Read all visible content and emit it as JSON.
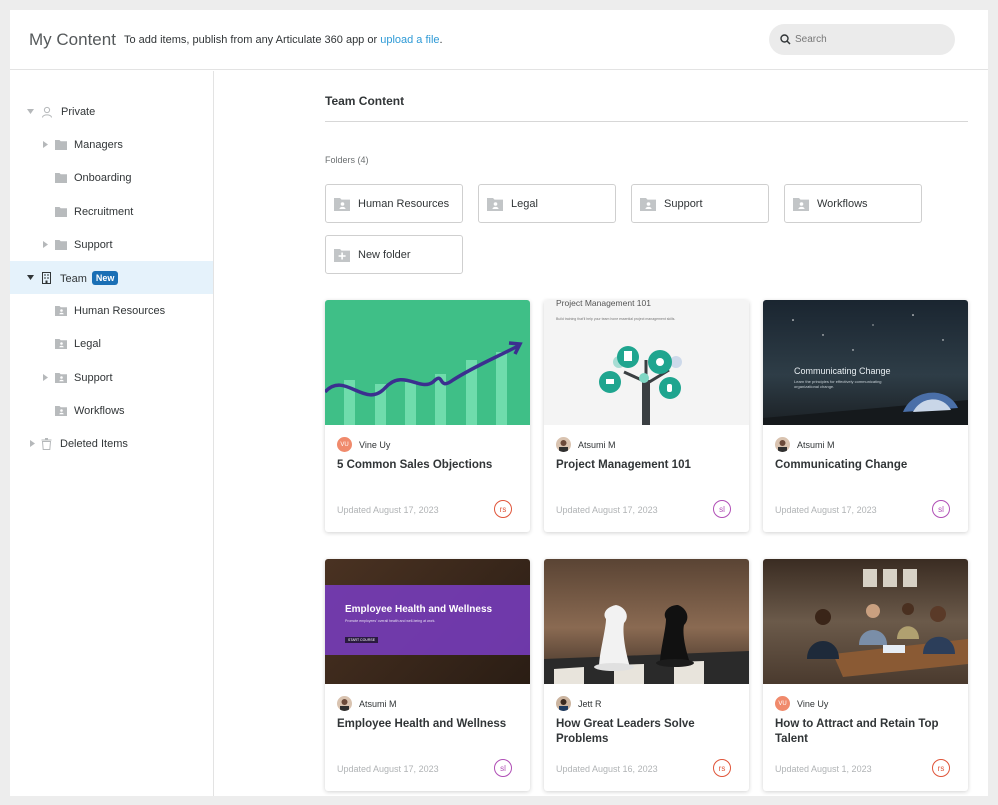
{
  "header": {
    "title": "My Content",
    "message_prefix": "To add items, publish from any Articulate 360 app or ",
    "upload_link": "upload a file",
    "message_suffix": ".",
    "search_placeholder": "Search"
  },
  "sidebar": {
    "items": [
      {
        "label": "Private"
      },
      {
        "label": "Managers"
      },
      {
        "label": "Onboarding"
      },
      {
        "label": "Recruitment"
      },
      {
        "label": "Support"
      },
      {
        "label": "Team",
        "badge": "New"
      },
      {
        "label": "Human Resources"
      },
      {
        "label": "Legal"
      },
      {
        "label": "Support"
      },
      {
        "label": "Workflows"
      },
      {
        "label": "Deleted Items"
      }
    ]
  },
  "main": {
    "section_title": "Team Content",
    "folders_label": "Folders (4)",
    "folders": [
      {
        "label": "Human Resources"
      },
      {
        "label": "Legal"
      },
      {
        "label": "Support"
      },
      {
        "label": "Workflows"
      }
    ],
    "new_folder_label": "New folder",
    "cards": [
      {
        "author": "Vine Uy",
        "author_initials": "VU",
        "title": "5 Common Sales Objections",
        "updated": "Updated August 17, 2023",
        "app": "rs"
      },
      {
        "author": "Atsumi M",
        "title": "Project Management 101",
        "updated": "Updated August 17, 2023",
        "app": "sl",
        "thumb_text": "Project Management 101",
        "thumb_subtext": "Build training that'll help your team hone essential project management skills."
      },
      {
        "author": "Atsumi M",
        "title": "Communicating Change",
        "updated": "Updated August 17, 2023",
        "app": "sl",
        "thumb_text": "Communicating Change",
        "thumb_subtext": "Learn the principles for effectively communicating organizational change."
      },
      {
        "author": "Atsumi M",
        "title": "Employee Health and Wellness",
        "updated": "Updated August 17, 2023",
        "app": "sl",
        "thumb_text": "Employee Health and Wellness",
        "thumb_subtext": "Promote employees' overall health and well-being at work.",
        "thumb_button": "START COURSE"
      },
      {
        "author": "Jett R",
        "title": "How Great Leaders Solve Problems",
        "updated": "Updated August 16, 2023",
        "app": "rs"
      },
      {
        "author": "Vine Uy",
        "author_initials": "VU",
        "title": "How to Attract and Retain Top Talent",
        "updated": "Updated August 1, 2023",
        "app": "rs"
      }
    ]
  },
  "colors": {
    "accent": "#2e9ad6",
    "badge": "#1a6fb5",
    "rise": "#e0553a",
    "storyline": "#b04fb6",
    "selected_bg": "#e5f2fb"
  }
}
